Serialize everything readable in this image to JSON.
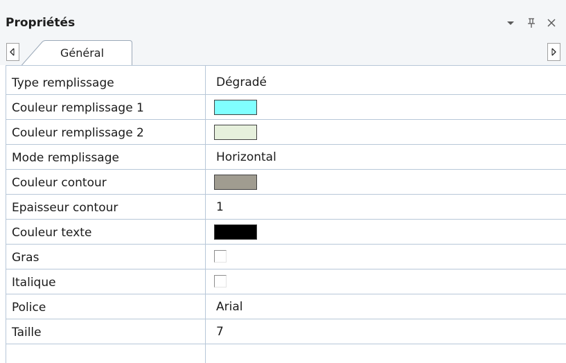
{
  "panel": {
    "title": "Propriétés",
    "controls": {
      "dropdown_icon": "triangle-down-icon",
      "pin_icon": "pin-icon",
      "close_icon": "close-icon"
    }
  },
  "tabs": [
    {
      "label": "Général",
      "active": true
    }
  ],
  "scroll": {
    "left_icon": "scroll-left-icon",
    "right_icon": "scroll-right-icon"
  },
  "properties": [
    {
      "name": "Type remplissage",
      "type": "text",
      "value": "Dégradé"
    },
    {
      "name": "Couleur remplissage 1",
      "type": "color",
      "color": "#80ffff"
    },
    {
      "name": "Couleur remplissage 2",
      "type": "color",
      "color": "#e6f0dc"
    },
    {
      "name": "Mode remplissage",
      "type": "text",
      "value": "Horizontal"
    },
    {
      "name": "Couleur contour",
      "type": "color",
      "color": "#a09c90"
    },
    {
      "name": "Epaisseur contour",
      "type": "text",
      "value": "1"
    },
    {
      "name": "Couleur texte",
      "type": "color",
      "color": "#000000"
    },
    {
      "name": "Gras",
      "type": "checkbox",
      "checked": false
    },
    {
      "name": "Italique",
      "type": "checkbox",
      "checked": false
    },
    {
      "name": "Police",
      "type": "text",
      "value": "Arial"
    },
    {
      "name": "Taille",
      "type": "text",
      "value": "7"
    }
  ],
  "colors": {
    "header_bg": "#f4f6f8",
    "grid_line": "#b7c7d8"
  }
}
